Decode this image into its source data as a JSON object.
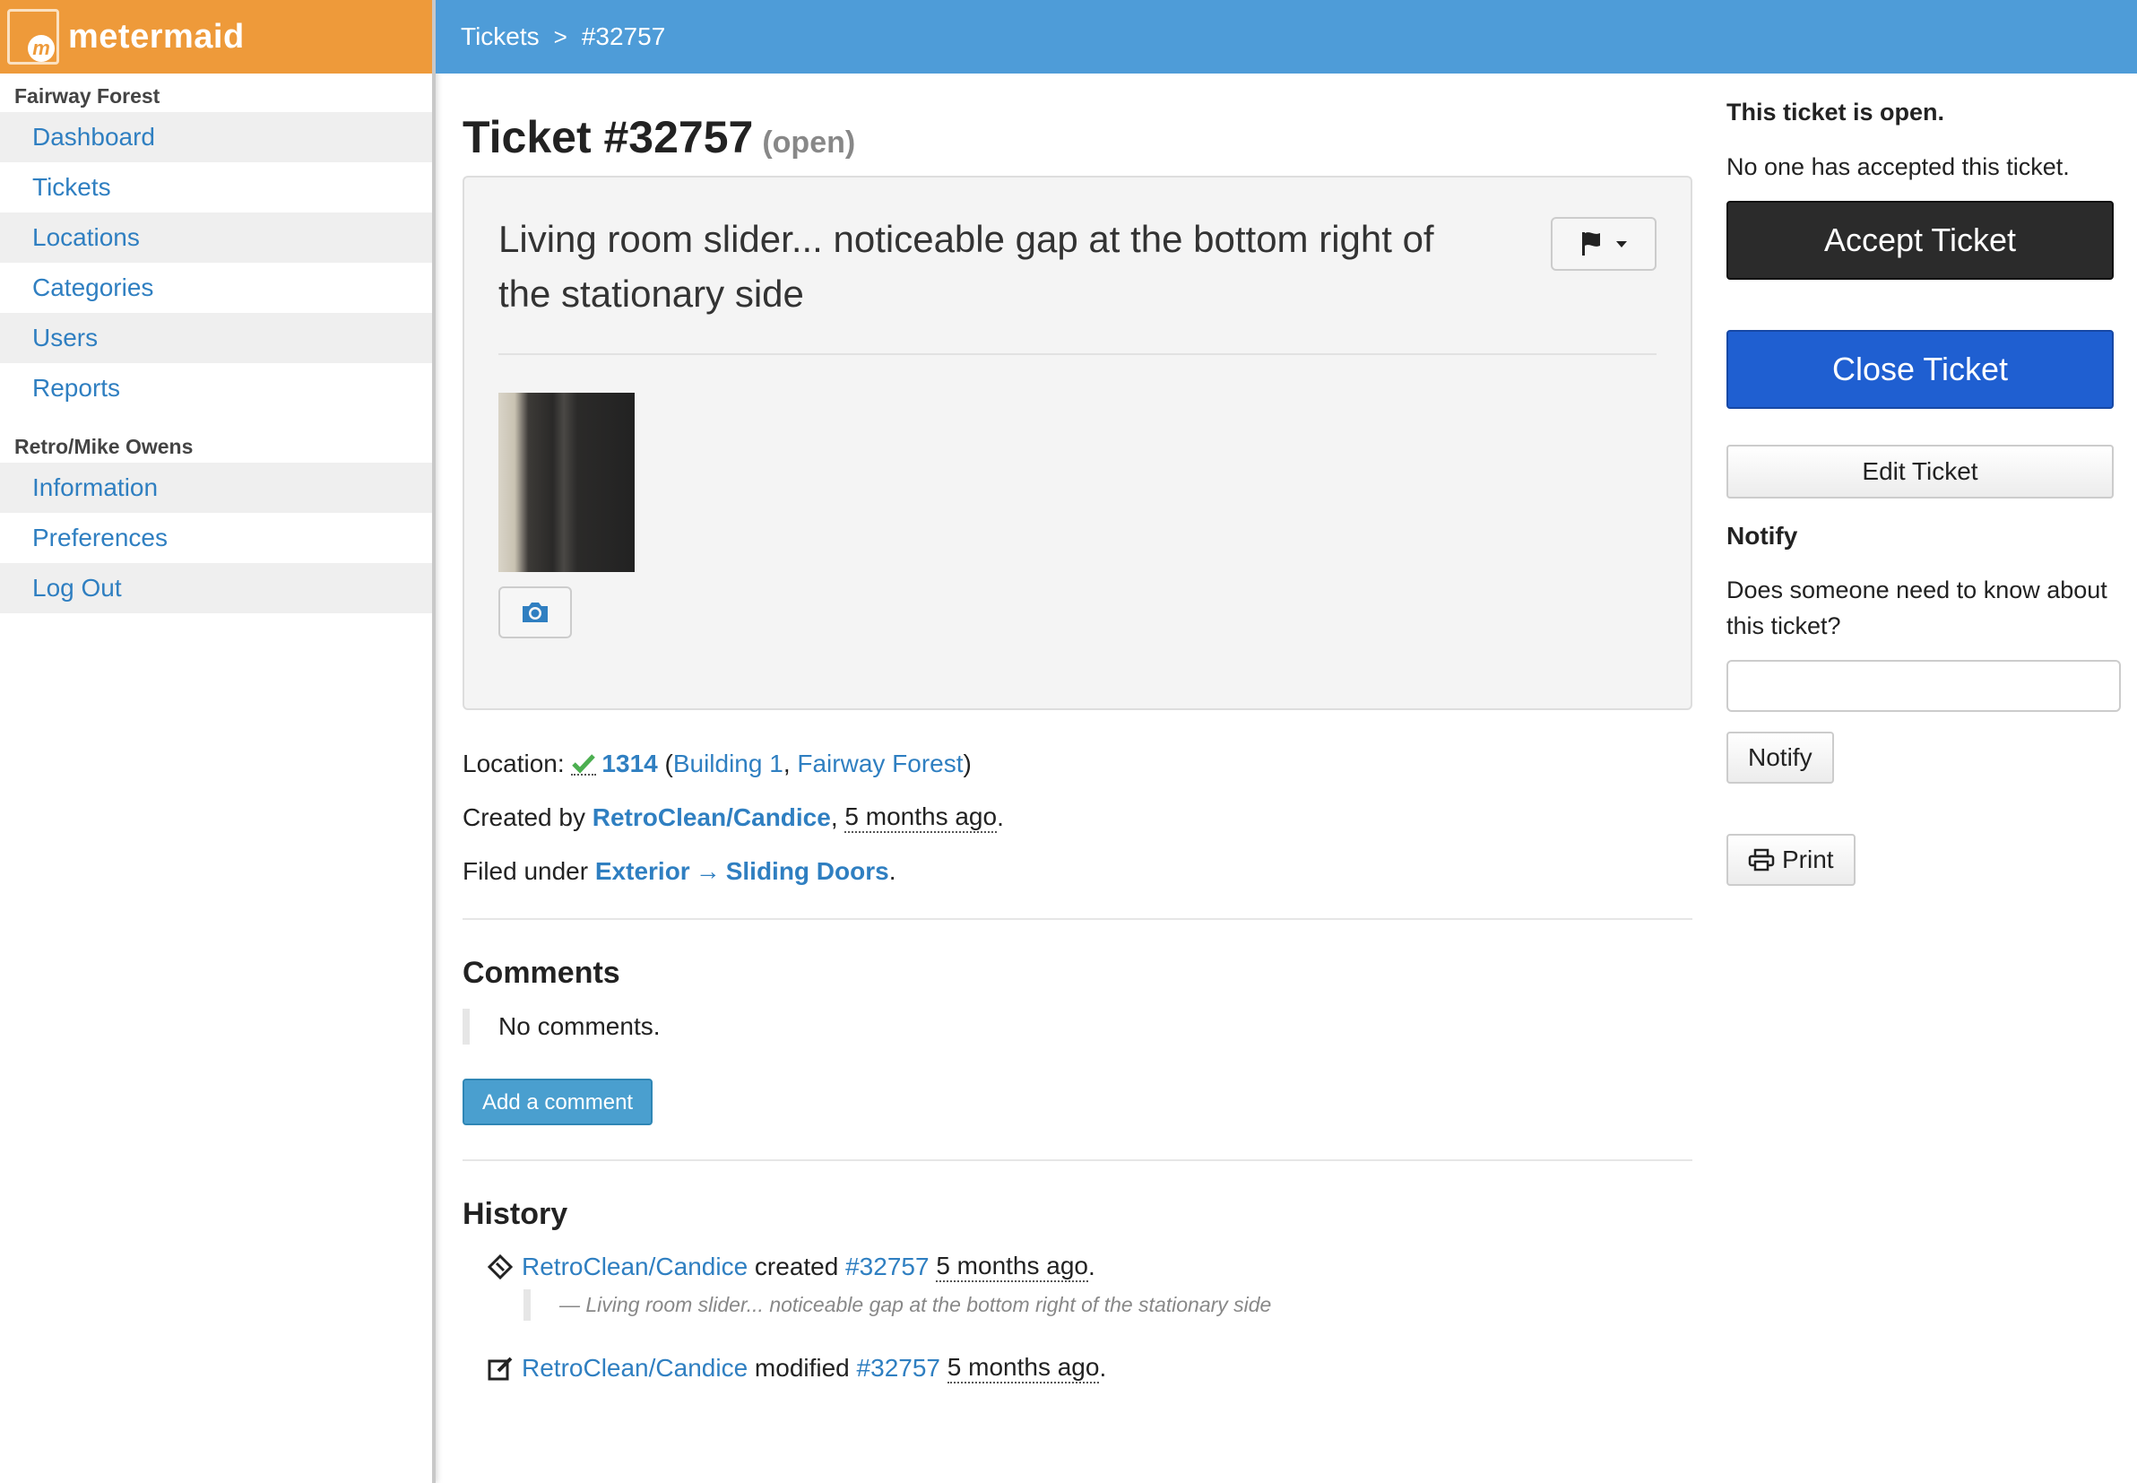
{
  "brand": {
    "name": "metermaid",
    "logo_letter": "m"
  },
  "sidebar": {
    "section1": "Fairway Forest",
    "items1": [
      {
        "label": "Dashboard"
      },
      {
        "label": "Tickets"
      },
      {
        "label": "Locations"
      },
      {
        "label": "Categories"
      },
      {
        "label": "Users"
      },
      {
        "label": "Reports"
      }
    ],
    "section2": "Retro/Mike Owens",
    "items2": [
      {
        "label": "Information"
      },
      {
        "label": "Preferences"
      },
      {
        "label": "Log Out"
      }
    ]
  },
  "breadcrumb": {
    "root": "Tickets",
    "separator": ">",
    "current": "#32757"
  },
  "ticket": {
    "title": "Ticket #32757",
    "status": "(open)",
    "description": "Living room slider... noticeable gap at the bottom right of the stationary side"
  },
  "meta": {
    "location_label": "Location:",
    "location_unit": "1314",
    "location_building": "Building 1",
    "location_site": "Fairway Forest",
    "created_by_label": "Created by",
    "created_by_user": "RetroClean/Candice",
    "created_when": "5 months ago",
    "filed_label": "Filed under",
    "category_parent": "Exterior",
    "category_arrow": "→",
    "category_child": "Sliding Doors"
  },
  "comments": {
    "heading": "Comments",
    "empty": "No comments.",
    "add_label": "Add a comment"
  },
  "history": {
    "heading": "History",
    "items": [
      {
        "user": "RetroClean/Candice",
        "action": "created",
        "ticket": "#32757",
        "when": "5 months ago",
        "quote": "— Living room slider... noticeable gap at the bottom right of the stationary side"
      },
      {
        "user": "RetroClean/Candice",
        "action": "modified",
        "ticket": "#32757",
        "when": "5 months ago"
      }
    ]
  },
  "right": {
    "status_text": "This ticket is open.",
    "accept_info": "No one has accepted this ticket.",
    "accept_label": "Accept Ticket",
    "close_label": "Close Ticket",
    "edit_label": "Edit Ticket",
    "notify_heading": "Notify",
    "notify_question": "Does someone need to know about this ticket?",
    "notify_input_value": "",
    "notify_label": "Notify",
    "print_label": "Print"
  },
  "colors": {
    "brand": "#ee9a3a",
    "topbar": "#4e9cd8",
    "link": "#2f7fc1",
    "accept": "#2b2b2b",
    "close": "#1f5fd1",
    "check": "#4caf50"
  },
  "icons": [
    "flag-icon",
    "caret-down-icon",
    "camera-icon",
    "check-icon",
    "ticket-icon",
    "edit-icon",
    "print-icon"
  ]
}
